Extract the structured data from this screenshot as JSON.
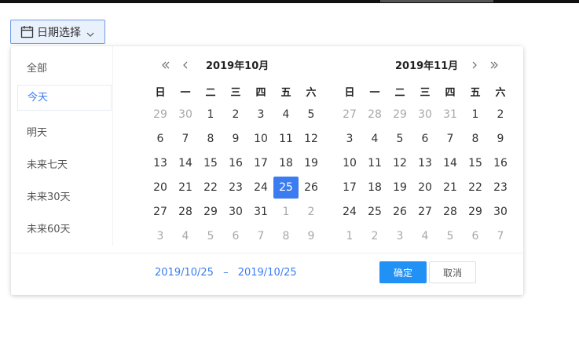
{
  "trigger": {
    "label": "日期选择",
    "icon": "calendar-icon",
    "chevron": "chevron-down-icon"
  },
  "shortcuts": [
    {
      "label": "全部",
      "active": false
    },
    {
      "label": "今天",
      "active": true
    },
    {
      "label": "明天",
      "active": false
    },
    {
      "label": "未来七天",
      "active": false
    },
    {
      "label": "未来30天",
      "active": false
    },
    {
      "label": "未来60天",
      "active": false
    }
  ],
  "weekdays": [
    "日",
    "一",
    "二",
    "三",
    "四",
    "五",
    "六"
  ],
  "left_calendar": {
    "title": "2019年10月",
    "weeks": [
      [
        "29",
        "30",
        "1",
        "2",
        "3",
        "4",
        "5"
      ],
      [
        "6",
        "7",
        "8",
        "9",
        "10",
        "11",
        "12"
      ],
      [
        "13",
        "14",
        "15",
        "16",
        "17",
        "18",
        "19"
      ],
      [
        "20",
        "21",
        "22",
        "23",
        "24",
        "25",
        "26"
      ],
      [
        "27",
        "28",
        "29",
        "30",
        "31",
        "1",
        "2"
      ],
      [
        "3",
        "4",
        "5",
        "6",
        "7",
        "8",
        "9"
      ]
    ],
    "first_current_index": 2,
    "last_current_index": 32,
    "selected_day": "25"
  },
  "right_calendar": {
    "title": "2019年11月",
    "weeks": [
      [
        "27",
        "28",
        "29",
        "30",
        "31",
        "1",
        "2"
      ],
      [
        "3",
        "4",
        "5",
        "6",
        "7",
        "8",
        "9"
      ],
      [
        "10",
        "11",
        "12",
        "13",
        "14",
        "15",
        "16"
      ],
      [
        "17",
        "18",
        "19",
        "20",
        "21",
        "22",
        "23"
      ],
      [
        "24",
        "25",
        "26",
        "27",
        "28",
        "29",
        "30"
      ],
      [
        "1",
        "2",
        "3",
        "4",
        "5",
        "6",
        "7"
      ]
    ],
    "first_current_index": 5,
    "last_current_index": 34
  },
  "footer": {
    "range_start": "2019/10/25",
    "range_sep": "–",
    "range_end": "2019/10/25",
    "ok_label": "确定",
    "cancel_label": "取消"
  },
  "colors": {
    "accent": "#3b7cf1",
    "ok_button": "#2291f5",
    "muted_day": "#a8a8a8"
  }
}
